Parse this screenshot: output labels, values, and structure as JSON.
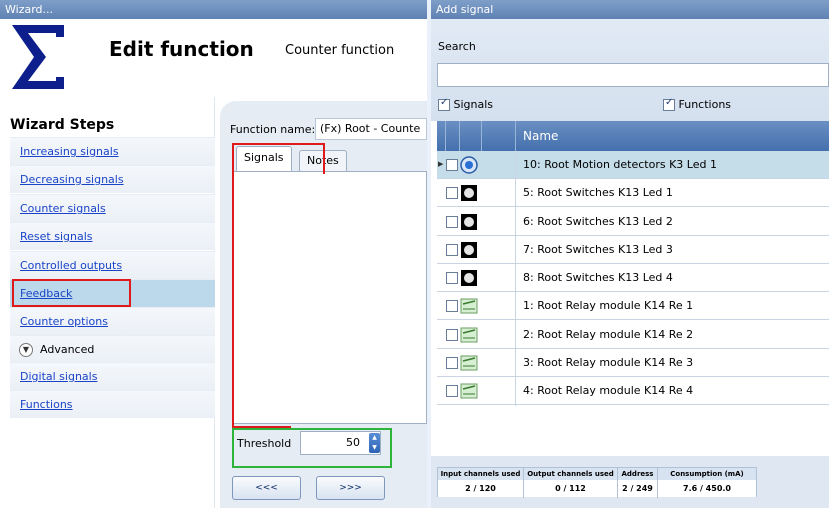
{
  "wizard": {
    "window_title": "Wizard...",
    "header_title": "Edit function",
    "header_subtitle": "Counter function",
    "steps_title": "Wizard Steps",
    "steps": [
      {
        "label": "Increasing signals"
      },
      {
        "label": "Decreasing signals"
      },
      {
        "label": "Counter signals"
      },
      {
        "label": "Reset signals"
      },
      {
        "label": "Controlled outputs"
      },
      {
        "label": "Feedback"
      },
      {
        "label": "Counter options"
      },
      {
        "label": "Advanced"
      },
      {
        "label": "Digital signals"
      },
      {
        "label": "Functions"
      }
    ],
    "function_name_label": "Function name:",
    "function_name_value": "(Fx) Root - Counte",
    "tabs": [
      "Signals",
      "Notes"
    ],
    "threshold_label": "Threshold",
    "threshold_value": "50",
    "back_button": "<<<",
    "next_button": ">>>"
  },
  "add_signal": {
    "window_title": "Add signal",
    "search_label": "Search",
    "search_value": "",
    "signals_checkbox": "Signals",
    "functions_checkbox": "Functions",
    "column_name": "Name",
    "rows": [
      {
        "label": "10: Root Motion detectors K3 Led 1",
        "icon": "motion-detector-icon"
      },
      {
        "label": "5: Root Switches K13 Led 1",
        "icon": "switch-icon"
      },
      {
        "label": "6: Root Switches K13 Led 2",
        "icon": "switch-icon"
      },
      {
        "label": "7: Root Switches K13 Led 3",
        "icon": "switch-icon"
      },
      {
        "label": "8: Root Switches K13 Led 4",
        "icon": "switch-icon"
      },
      {
        "label": "1: Root Relay module K14 Re 1",
        "icon": "relay-icon"
      },
      {
        "label": "2: Root Relay module K14 Re 2",
        "icon": "relay-icon"
      },
      {
        "label": "3: Root Relay module K14 Re 3",
        "icon": "relay-icon"
      },
      {
        "label": "4: Root Relay module K14 Re 4",
        "icon": "relay-icon"
      }
    ],
    "stats": {
      "headers": [
        "Input channels used",
        "Output channels used",
        "Address",
        "Consumption (mA)"
      ],
      "values": [
        "2 / 120",
        "0 / 112",
        "2 / 249",
        "7.6 / 450.0"
      ]
    }
  },
  "colors": {
    "accent": "#4470ad",
    "highlight_red": "#e0191a",
    "highlight_green": "#2cb53a",
    "link": "#1a44c7"
  }
}
